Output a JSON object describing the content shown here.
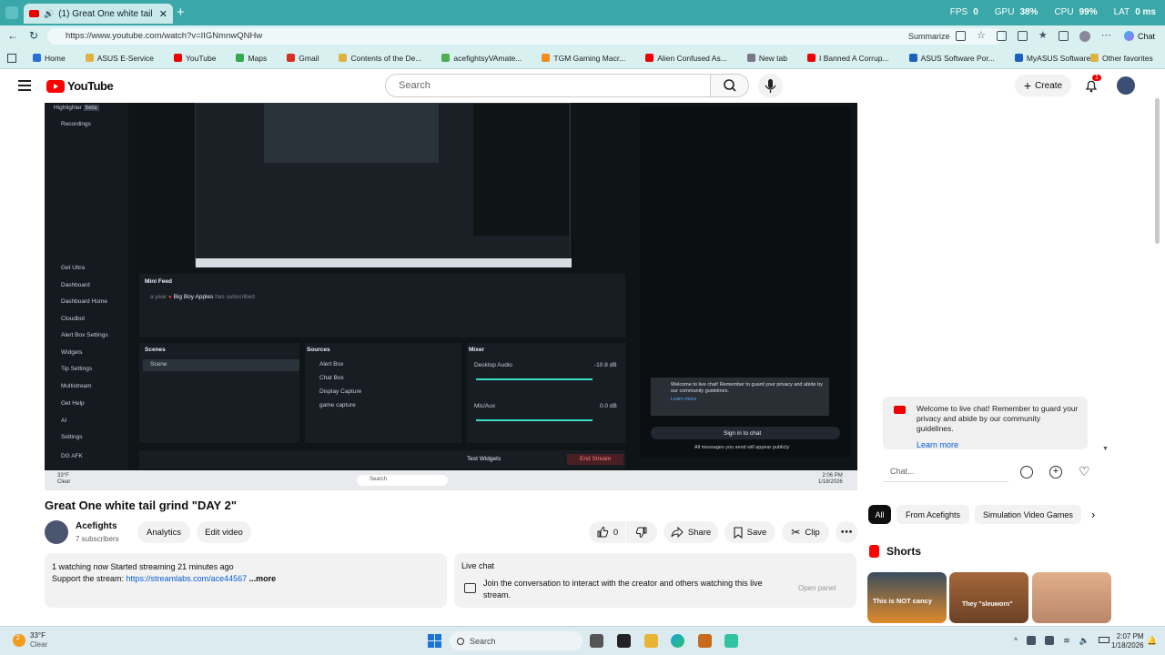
{
  "browser": {
    "tab_title": "(1) Great One white tail grind",
    "perf": {
      "fps_label": "FPS",
      "fps": "0",
      "gpu_label": "GPU",
      "gpu": "38%",
      "cpu_label": "CPU",
      "cpu": "99%",
      "lat_label": "LAT",
      "lat": "0 ms"
    },
    "url": "https://www.youtube.com/watch?v=IIGNmnwQNHw",
    "summarize": "Summarize",
    "chat_label": "Chat",
    "bookmarks": [
      "Home",
      "ASUS E-Service",
      "YouTube",
      "Maps",
      "Gmail",
      "Contents of the De...",
      "acefightsyVAmate...",
      "TGM Gaming Macr...",
      "Alien Confused As...",
      "New tab",
      "I Banned A Corrup...",
      "ASUS Software Por...",
      "MyASUS Software..."
    ],
    "other_favorites": "Other favorites"
  },
  "yt": {
    "logo_text": "YouTube",
    "search_placeholder": "Search",
    "create_label": "Create",
    "notif_count": "1"
  },
  "obs": {
    "sidebar": [
      {
        "label": "Highlighter",
        "badge": "beta"
      },
      {
        "label": "Recordings"
      },
      {
        "label": "Get Ultra"
      },
      {
        "label": "Dashboard"
      },
      {
        "label": "Dashboard Home"
      },
      {
        "label": "Cloudbot"
      },
      {
        "label": "Alert Box Settings"
      },
      {
        "label": "Widgets"
      },
      {
        "label": "Tip Settings"
      },
      {
        "label": "Multistream"
      },
      {
        "label": "Get Help"
      },
      {
        "label": "AI"
      },
      {
        "label": "Settings"
      },
      {
        "label": "DG AFK"
      }
    ],
    "mini_feed": "Mini Feed",
    "feed_time": "a year",
    "feed_user": "Big Boy Apples",
    "feed_action": "has subscribed",
    "scenes": "Scenes",
    "scene_item": "Scene",
    "sources": "Sources",
    "source_items": [
      "Alert Box",
      "Chat Box",
      "Display Capture",
      "game capture"
    ],
    "mixer": "Mixer",
    "desktop_audio": "Desktop Audio",
    "desktop_db": "-10.8 dB",
    "mic_aux": "Mic/Aux",
    "mic_db": "0.0 dB",
    "test_widgets": "Test Widgets",
    "end_stream": "End Stream",
    "chat_welcome": "Welcome to live chat! Remember to guard your privacy and abide by our community guidelines.",
    "learn_more": "Learn more",
    "sign_in_chat": "Sign in to chat",
    "all_messages": "All messages you send will appear publicly",
    "inner_search": "Search",
    "inner_time": "2:06 PM",
    "inner_date": "1/18/2026",
    "inner_weather": "33°F",
    "inner_weather_desc": "Clear"
  },
  "video_meta": {
    "title": "Great One white tail grind \"DAY 2\"",
    "channel": "Acefights",
    "subscribers": "7 subscribers",
    "analytics": "Analytics",
    "edit_video": "Edit video",
    "likes": "0",
    "share": "Share",
    "save": "Save",
    "clip": "Clip"
  },
  "description": {
    "stats": "1 watching now  Started streaming 21 minutes ago",
    "support_prefix": "Support the stream: ",
    "support_link": "https://streamlabs.com/ace44567",
    "more": " ...more"
  },
  "live_chat_box": {
    "title": "Live chat",
    "text": "Join the conversation to interact with the creator and others watching this live stream.",
    "open_panel": "Open panel"
  },
  "right": {
    "welcome": "Welcome to live chat! Remember to guard your privacy and abide by our community guidelines.",
    "learn_more": "Learn more",
    "chat_placeholder": "Chat...",
    "chips": [
      "All",
      "From Acefights",
      "Simulation Video Games"
    ],
    "shorts_title": "Shorts",
    "shorts": [
      {
        "caption": "This is NOT cancy"
      },
      {
        "caption": "They \"sleuworn\""
      },
      {
        "caption": ""
      }
    ]
  },
  "os": {
    "weather_temp": "33°F",
    "weather_desc": "Clear",
    "search": "Search",
    "time": "2:07 PM",
    "date": "1/18/2026",
    "notif": "2"
  }
}
